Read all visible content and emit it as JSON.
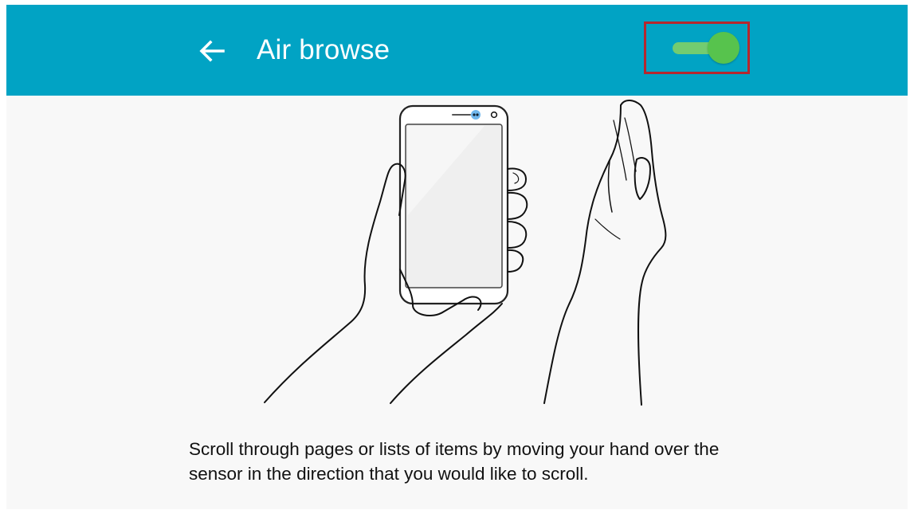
{
  "header": {
    "title": "Air browse"
  },
  "toggle": {
    "state": "on",
    "accent_color": "#57c34d"
  },
  "description": {
    "text": "Scroll through pages or lists of items by moving your hand over the sensor in the direction that you would like to scroll."
  },
  "colors": {
    "app_bar": "#01a3c4",
    "highlight_box": "#b6272d",
    "background": "#f8f8f8"
  },
  "icons": {
    "back": "arrow-left-icon"
  }
}
